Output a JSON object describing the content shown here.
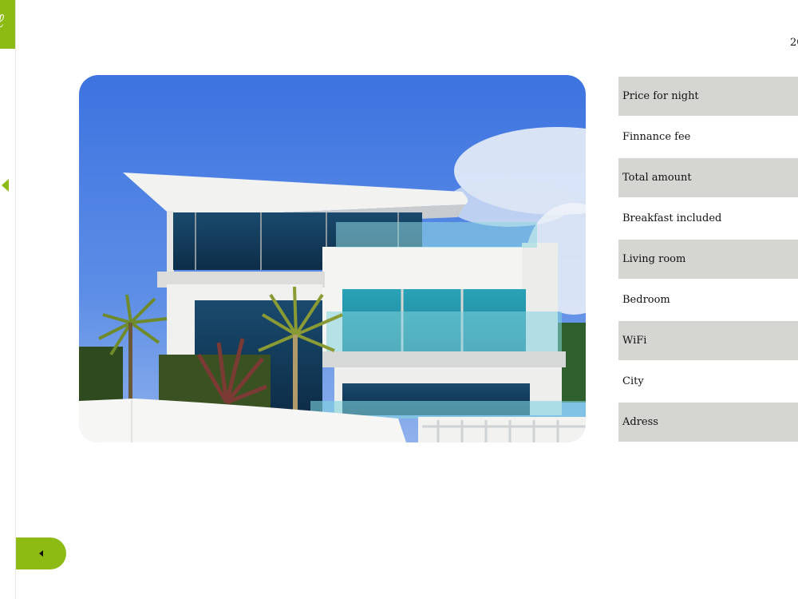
{
  "header": {
    "year_partial": "20"
  },
  "icons": {
    "logo": "logo-mark",
    "rail_arrow": "caret-left-icon",
    "collapse": "caret-left-icon"
  },
  "colors": {
    "accent": "#8dbb14",
    "row_shade": "#d5d5d1"
  },
  "property": {
    "image_alt": "Modern white house with glass balconies and palm trees",
    "details": [
      {
        "label": "Price for night"
      },
      {
        "label": "Finnance fee"
      },
      {
        "label": "Total amount"
      },
      {
        "label": "Breakfast included"
      },
      {
        "label": "Living room"
      },
      {
        "label": "Bedroom"
      },
      {
        "label": "WiFi"
      },
      {
        "label": "City"
      },
      {
        "label": "Adress"
      }
    ]
  }
}
